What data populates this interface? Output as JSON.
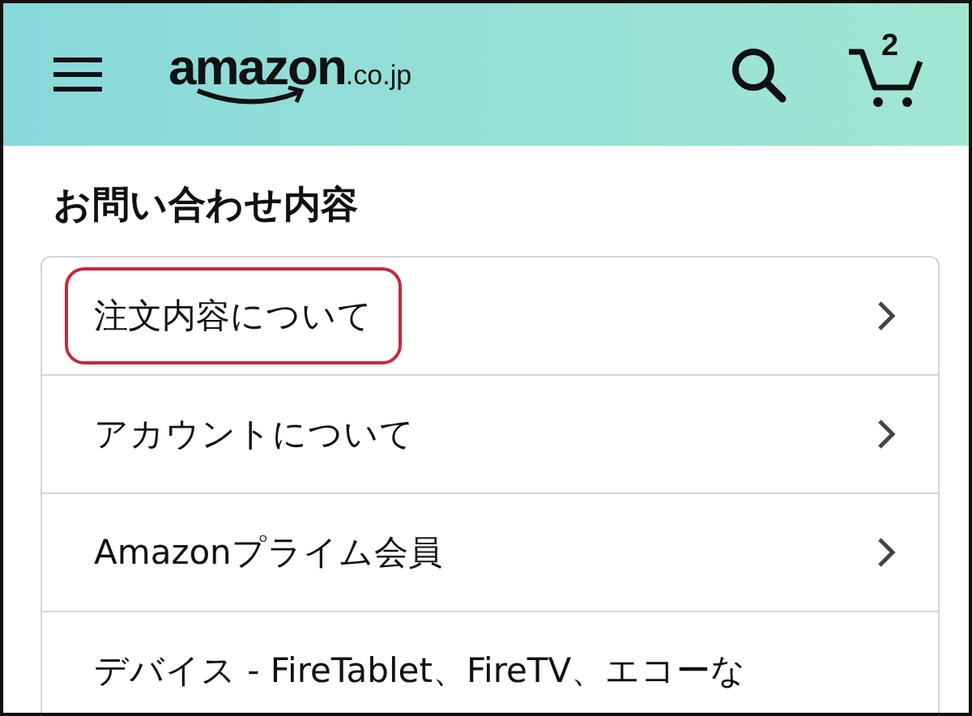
{
  "header": {
    "logo": "amazon",
    "logo_suffix": ".co.jp",
    "cart_count": "2"
  },
  "section_title": "お問い合わせ内容",
  "items": [
    {
      "label": "注文内容について",
      "highlighted": true,
      "chevron": true
    },
    {
      "label": "アカウントについて",
      "highlighted": false,
      "chevron": true
    },
    {
      "label": "Amazonプライム会員",
      "highlighted": false,
      "chevron": true
    },
    {
      "label": "デバイス - FireTablet、FireTV、エコーな",
      "highlighted": false,
      "chevron": false
    }
  ]
}
